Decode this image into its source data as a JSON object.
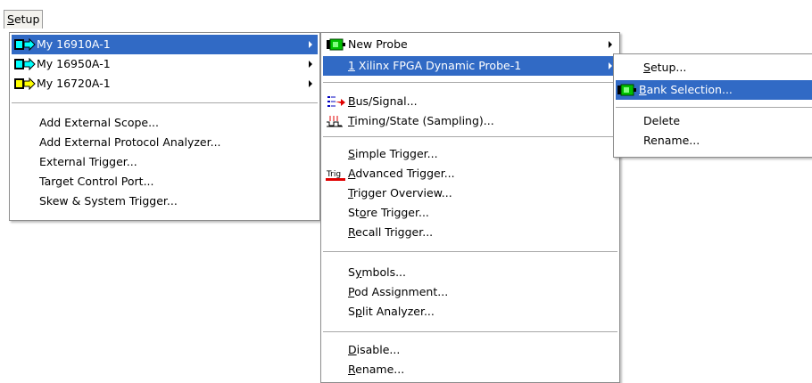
{
  "menubar": {
    "setup": "Setup"
  },
  "menu1": {
    "analyzers": [
      {
        "label": "My 16910A-1",
        "icon": "analyzer-cyan-icon",
        "color": "#00ffff",
        "has_submenu": true,
        "highlighted": true
      },
      {
        "label": "My 16950A-1",
        "icon": "analyzer-cyan-icon",
        "color": "#00ffff",
        "has_submenu": true,
        "highlighted": false
      },
      {
        "label": "My 16720A-1",
        "icon": "analyzer-yellow-icon",
        "color": "#ffff00",
        "has_submenu": true,
        "highlighted": false
      }
    ],
    "actions": [
      "Add External Scope...",
      "Add External Protocol Analyzer...",
      "External Trigger...",
      "Target Control Port...",
      "Skew & System Trigger..."
    ]
  },
  "menu2": {
    "new_probe": "New Probe",
    "probe_item_prefix": "1",
    "probe_item": " Xilinx FPGA Dynamic Probe-1",
    "bus_signal": {
      "pre": "",
      "u": "B",
      "post": "us/Signal..."
    },
    "timing_state": {
      "pre": "",
      "u": "T",
      "post": "iming/State (Sampling)..."
    },
    "simple_trigger": {
      "pre": "",
      "u": "S",
      "post": "imple Trigger..."
    },
    "advanced_trigger": {
      "pre": "",
      "u": "A",
      "post": "dvanced Trigger..."
    },
    "trig_icon_text": "Trig",
    "trigger_overview": {
      "pre": "",
      "u": "T",
      "post": "rigger Overview..."
    },
    "store_trigger": {
      "pre": "St",
      "u": "o",
      "post": "re Trigger..."
    },
    "recall_trigger": {
      "pre": "",
      "u": "R",
      "post": "ecall Trigger..."
    },
    "symbols": {
      "pre": "S",
      "u": "y",
      "post": "mbols..."
    },
    "pod_assignment": {
      "pre": "",
      "u": "P",
      "post": "od Assignment..."
    },
    "split_analyzer": {
      "pre": "S",
      "u": "p",
      "post": "lit Analyzer..."
    },
    "disable": {
      "pre": "",
      "u": "D",
      "post": "isable..."
    },
    "rename": {
      "pre": "",
      "u": "R",
      "post": "ename..."
    }
  },
  "menu3": {
    "setup": {
      "pre": "",
      "u": "S",
      "post": "etup..."
    },
    "bank_selection": {
      "pre": "",
      "u": "B",
      "post": "ank Selection..."
    },
    "delete": "Delete",
    "rename": "Rename..."
  },
  "colors": {
    "highlight": "#316ac5",
    "probe_green": "#00c000"
  }
}
